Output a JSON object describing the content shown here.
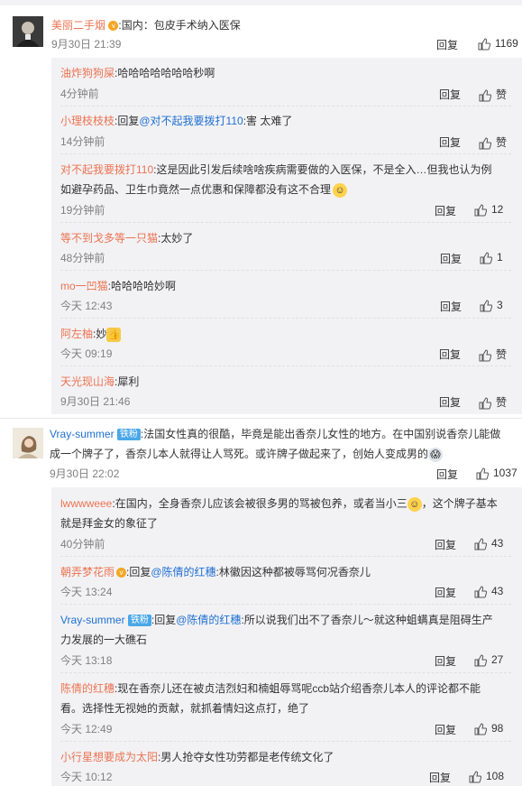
{
  "threads": [
    {
      "user": "美丽二手烟",
      "text": ":国内：包皮手术纳入医保",
      "time": "9月30日 21:39",
      "reply": "回复",
      "likes": "1169",
      "replies": [
        {
          "user": "油炸狗狗屎",
          "text": ":哈哈哈哈哈哈哈秒啊",
          "time": "4分钟前",
          "reply": "回复",
          "likes": "赞"
        },
        {
          "user": "小理枝枝枝",
          "prefix": ":回复",
          "mention": "@对不起我要拨打110",
          "text": ":害 太难了",
          "time": "14分钟前",
          "reply": "回复",
          "likes": "赞"
        },
        {
          "user": "对不起我要拨打110",
          "text": ":这是因此引发后续啥啥疾病需要做的入医保，不是全入…但我也认为例",
          "text2": "如避孕药品、卫生巾竟然一点优惠和保障都没有这不合理",
          "time": "19分钟前",
          "reply": "回复",
          "likes": "12"
        },
        {
          "user": "等不到戈多等一只猫",
          "text": ":太妙了",
          "time": "48分钟前",
          "reply": "回复",
          "likes": "1"
        },
        {
          "user": "mo一凹猫",
          "text": ":哈哈哈哈妙啊",
          "time": "今天 12:43",
          "reply": "回复",
          "likes": "3"
        },
        {
          "user": "阿左柚",
          "text": ":妙",
          "time": "今天 09:19",
          "reply": "回复",
          "likes": "赞"
        },
        {
          "user": "天光现山海",
          "text": ":犀利",
          "time": "9月30日 21:46",
          "reply": "回复",
          "likes": "赞"
        }
      ]
    },
    {
      "user": "Vray-summer",
      "badge": "铁粉",
      "text": ":法国女性真的很酷，毕竟是能出香奈儿女性的地方。在中国别说香奈儿能做",
      "text2": "成一个牌子了，香奈儿本人就得让人骂死。或许牌子做起来了，创始人变成男的",
      "time": "9月30日 22:02",
      "reply": "回复",
      "likes": "1037",
      "replies": [
        {
          "user": "lwwwweee",
          "text": ":在国内，全身香奈儿应该会被很多男的骂被包养，或者当小三",
          "text_tail": "，这个牌子基本",
          "text2": "就是拜金女的象征了",
          "time": "40分钟前",
          "reply": "回复",
          "likes": "43"
        },
        {
          "user": "朝弄梦花雨",
          "prefix": ":回复",
          "mention": "@陈倩的红穗",
          "text": ":林徽因这种都被辱骂何况香奈儿",
          "time": "今天 13:24",
          "reply": "回复",
          "likes": "43"
        },
        {
          "user": "Vray-summer",
          "badge": "铁粉",
          "prefix": ":回复",
          "mention": "@陈倩的红穗",
          "text": ":所以说我们出不了香奈儿～就这种蛆螨真是阻碍生产",
          "text2": "力发展的一大礁石",
          "time": "今天 13:18",
          "reply": "回复",
          "likes": "27"
        },
        {
          "user": "陈倩的红穗",
          "text": ":现在香奈儿还在被贞洁烈妇和楠蛆辱骂呢ccb站介绍香奈儿本人的评论都不能",
          "text2": "看。选择性无视她的贡献，就抓着情妇这点打，绝了",
          "time": "今天 12:49",
          "reply": "回复",
          "likes": "98"
        },
        {
          "user": "小行星想要成为太阳",
          "text": ":男人抢夺女性功劳都是老传统文化了",
          "time": "今天 10:12",
          "reply": "回复",
          "likes": "108"
        }
      ]
    }
  ]
}
